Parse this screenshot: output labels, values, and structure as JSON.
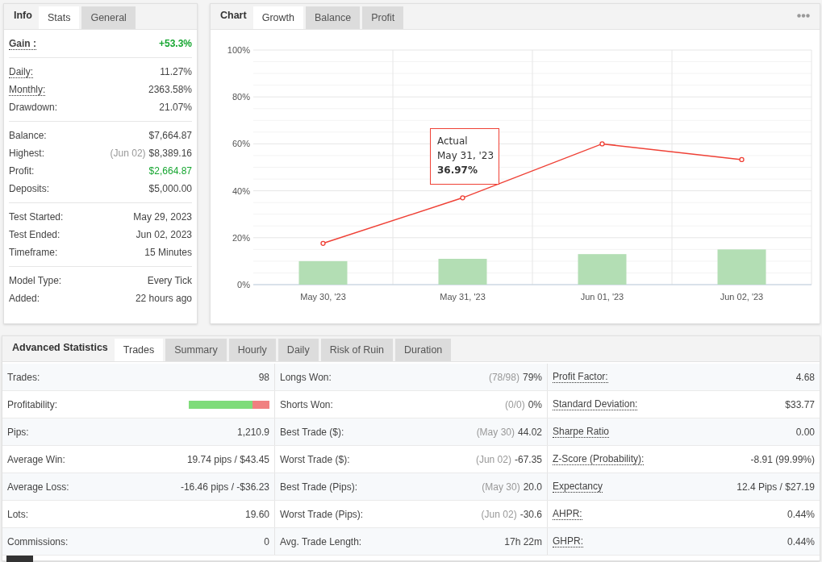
{
  "info_panel": {
    "title": "Info",
    "tabs": [
      {
        "label": "Stats",
        "selected": true
      },
      {
        "label": "General",
        "selected": false
      }
    ],
    "groups": [
      [
        {
          "label": "Gain :",
          "value": "+53.3%",
          "dotted": true,
          "positive": true,
          "bold": true
        }
      ],
      [
        {
          "label": "Daily:",
          "value": "11.27%",
          "dotted": true,
          "positive": false
        },
        {
          "label": "Monthly:",
          "value": "2363.58%",
          "dotted": true,
          "positive": false
        },
        {
          "label": "Drawdown:",
          "value": "21.07%",
          "dotted": false,
          "positive": false
        }
      ],
      [
        {
          "label": "Balance:",
          "value": "$7,664.87",
          "dotted": false,
          "positive": false
        },
        {
          "label": "Highest:",
          "note": "(Jun 02)",
          "value": "$8,389.16",
          "dotted": false,
          "positive": false
        },
        {
          "label": "Profit:",
          "value": "$2,664.87",
          "dotted": false,
          "positive": true
        },
        {
          "label": "Deposits:",
          "value": "$5,000.00",
          "dotted": false,
          "positive": false
        }
      ],
      [
        {
          "label": "Test Started:",
          "value": "May 29, 2023",
          "dotted": false,
          "positive": false
        },
        {
          "label": "Test Ended:",
          "value": "Jun 02, 2023",
          "dotted": false,
          "positive": false
        },
        {
          "label": "Timeframe:",
          "value": "15 Minutes",
          "dotted": false,
          "positive": false
        }
      ],
      [
        {
          "label": "Model Type:",
          "value": "Every Tick",
          "dotted": false,
          "positive": false
        },
        {
          "label": "Added:",
          "value": "22 hours ago",
          "dotted": false,
          "positive": false
        }
      ]
    ]
  },
  "chart_panel": {
    "title": "Chart",
    "tabs": [
      {
        "label": "Growth",
        "selected": true
      },
      {
        "label": "Balance",
        "selected": false
      },
      {
        "label": "Profit",
        "selected": false
      }
    ],
    "chart_data": {
      "type": "line",
      "categories": [
        "May 30, '23",
        "May 31, '23",
        "Jun 01, '23",
        "Jun 02, '23"
      ],
      "series": [
        {
          "name": "Actual",
          "type": "line",
          "color": "#ef4136",
          "marker": true,
          "values": [
            17.6,
            37,
            60,
            53.3
          ]
        },
        {
          "type": "bar",
          "color": "#b3deb4",
          "values": [
            10,
            11,
            13,
            15
          ]
        }
      ],
      "ylim": [
        0,
        100
      ],
      "grid": true,
      "yticks": [
        {
          "value": 0,
          "label": "0%"
        },
        {
          "value": 20,
          "label": "20%"
        },
        {
          "value": 40,
          "label": "40%"
        },
        {
          "value": 60,
          "label": "60%"
        },
        {
          "value": 80,
          "label": "80%"
        },
        {
          "value": 100,
          "label": "100%"
        }
      ]
    },
    "tooltip": {
      "date": "May 31, '23",
      "value": "36.97%"
    }
  },
  "advanced": {
    "title": "Advanced Statistics",
    "tabs": [
      {
        "label": "Trades",
        "selected": true
      },
      {
        "label": "Summary",
        "selected": false
      },
      {
        "label": "Hourly",
        "selected": false
      },
      {
        "label": "Daily",
        "selected": false
      },
      {
        "label": "Risk of Ruin",
        "selected": false
      },
      {
        "label": "Duration",
        "selected": false
      }
    ],
    "rows": [
      [
        {
          "label": "Trades:",
          "value": "98",
          "dotted": false
        },
        {
          "label": "Longs Won:",
          "note": "(78/98)",
          "value": "79%",
          "dotted": false
        },
        {
          "label": "Profit Factor:",
          "value": "4.68",
          "dotted": true
        }
      ],
      [
        {
          "label": "Profitability:",
          "kind": "bar",
          "level": 0.79,
          "dotted": false
        },
        {
          "label": "Shorts Won:",
          "note": "(0/0)",
          "value": "0%",
          "dotted": false
        },
        {
          "label": "Standard Deviation:",
          "value": "$33.77",
          "dotted": true
        }
      ],
      [
        {
          "label": "Pips:",
          "value": "1,210.9",
          "dotted": false
        },
        {
          "label": "Best Trade ($):",
          "note": "(May 30)",
          "value": "44.02",
          "dotted": false
        },
        {
          "label": "Sharpe Ratio",
          "value": "0.00",
          "dotted": true
        }
      ],
      [
        {
          "label": "Average Win:",
          "value": "19.74 pips / $43.45",
          "dotted": false
        },
        {
          "label": "Worst Trade ($):",
          "note": "(Jun 02)",
          "value": "-67.35",
          "dotted": false
        },
        {
          "label": "Z-Score (Probability):",
          "value": "-8.91 (99.99%)",
          "dotted": true
        }
      ],
      [
        {
          "label": "Average Loss:",
          "value": "-16.46 pips / -$36.23",
          "dotted": false
        },
        {
          "label": "Best Trade (Pips):",
          "note": "(May 30)",
          "value": "20.0",
          "dotted": false
        },
        {
          "label": "Expectancy",
          "value": "12.4 Pips / $27.19",
          "dotted": true
        }
      ],
      [
        {
          "label": "Lots:",
          "value": "19.60",
          "dotted": false
        },
        {
          "label": "Worst Trade (Pips):",
          "note": "(Jun 02)",
          "value": "-30.6",
          "dotted": false
        },
        {
          "label": "AHPR:",
          "value": "0.44%",
          "dotted": true
        }
      ],
      [
        {
          "label": "Commissions:",
          "value": "0",
          "dotted": false
        },
        {
          "label": "Avg. Trade Length:",
          "value": "17h 22m",
          "dotted": false
        },
        {
          "label": "GHPR:",
          "value": "0.44%",
          "dotted": true
        }
      ]
    ]
  }
}
